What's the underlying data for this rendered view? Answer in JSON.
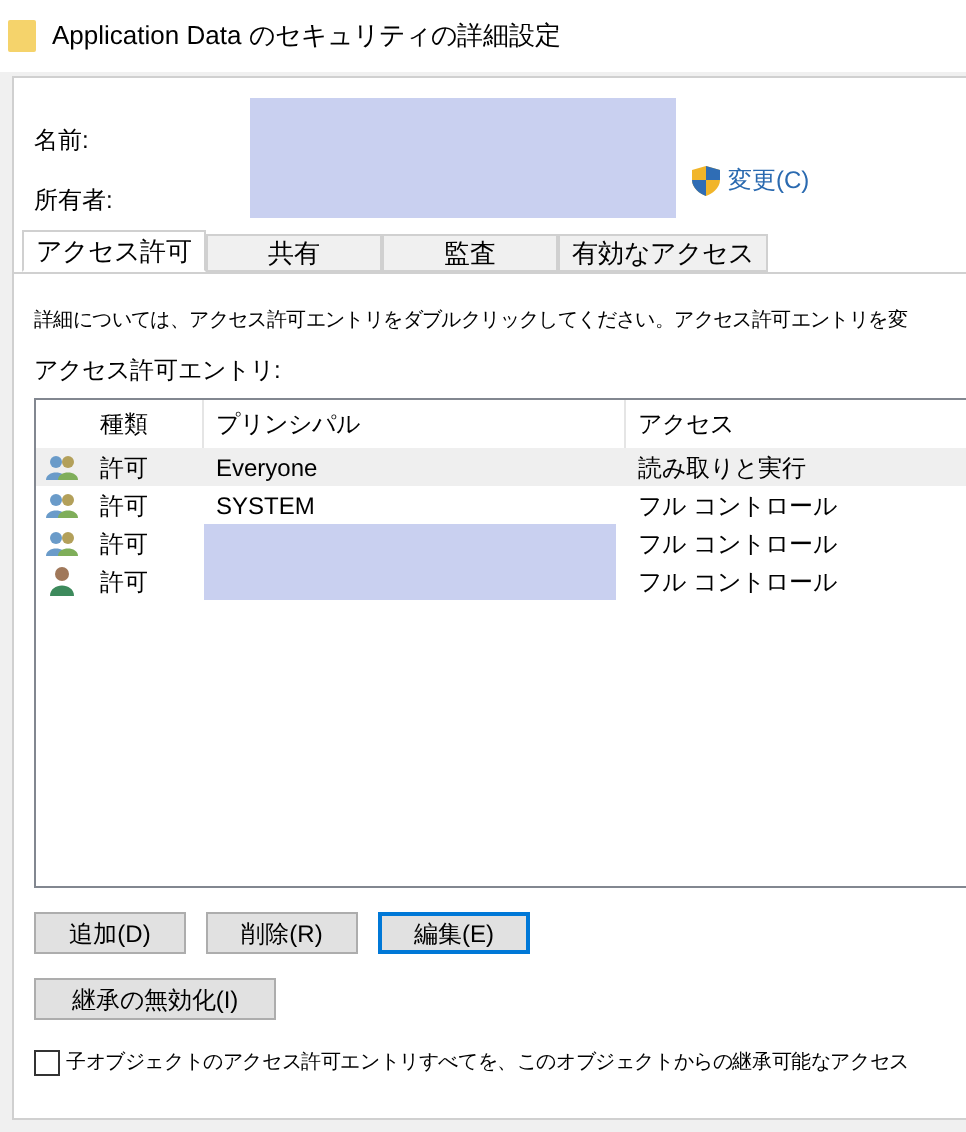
{
  "window": {
    "title": "Application Data のセキュリティの詳細設定"
  },
  "name_label": "名前:",
  "owner_label": "所有者:",
  "change_link": "変更(C)",
  "tabs": [
    {
      "label": "アクセス許可",
      "selected": true
    },
    {
      "label": "共有",
      "selected": false
    },
    {
      "label": "監査",
      "selected": false
    },
    {
      "label": "有効なアクセス",
      "selected": false
    }
  ],
  "info_text": "詳細については、アクセス許可エントリをダブルクリックしてください。アクセス許可エントリを変",
  "entries_label": "アクセス許可エントリ:",
  "table": {
    "columns": [
      "種類",
      "プリンシパル",
      "アクセス"
    ],
    "rows": [
      {
        "kind": "group",
        "type": "許可",
        "principal": "Everyone",
        "access": "読み取りと実行",
        "selected": true,
        "redacted": false
      },
      {
        "kind": "group",
        "type": "許可",
        "principal": "SYSTEM",
        "access": "フル コントロール",
        "selected": false,
        "redacted": false
      },
      {
        "kind": "group",
        "type": "許可",
        "access": "フル コントロール",
        "selected": false,
        "redacted": true
      },
      {
        "kind": "user",
        "type": "許可",
        "access": "フル コントロール",
        "selected": false,
        "redacted": true
      }
    ]
  },
  "buttons": [
    {
      "label": "追加(D)",
      "focused": false
    },
    {
      "label": "削除(R)",
      "focused": false
    },
    {
      "label": "編集(E)",
      "focused": true
    }
  ],
  "inherit_button": "継承の無効化(I)",
  "replace_checkbox": {
    "label": "子オブジェクトのアクセス許可エントリすべてを、このオブジェクトからの継承可能なアクセス",
    "checked": false
  }
}
